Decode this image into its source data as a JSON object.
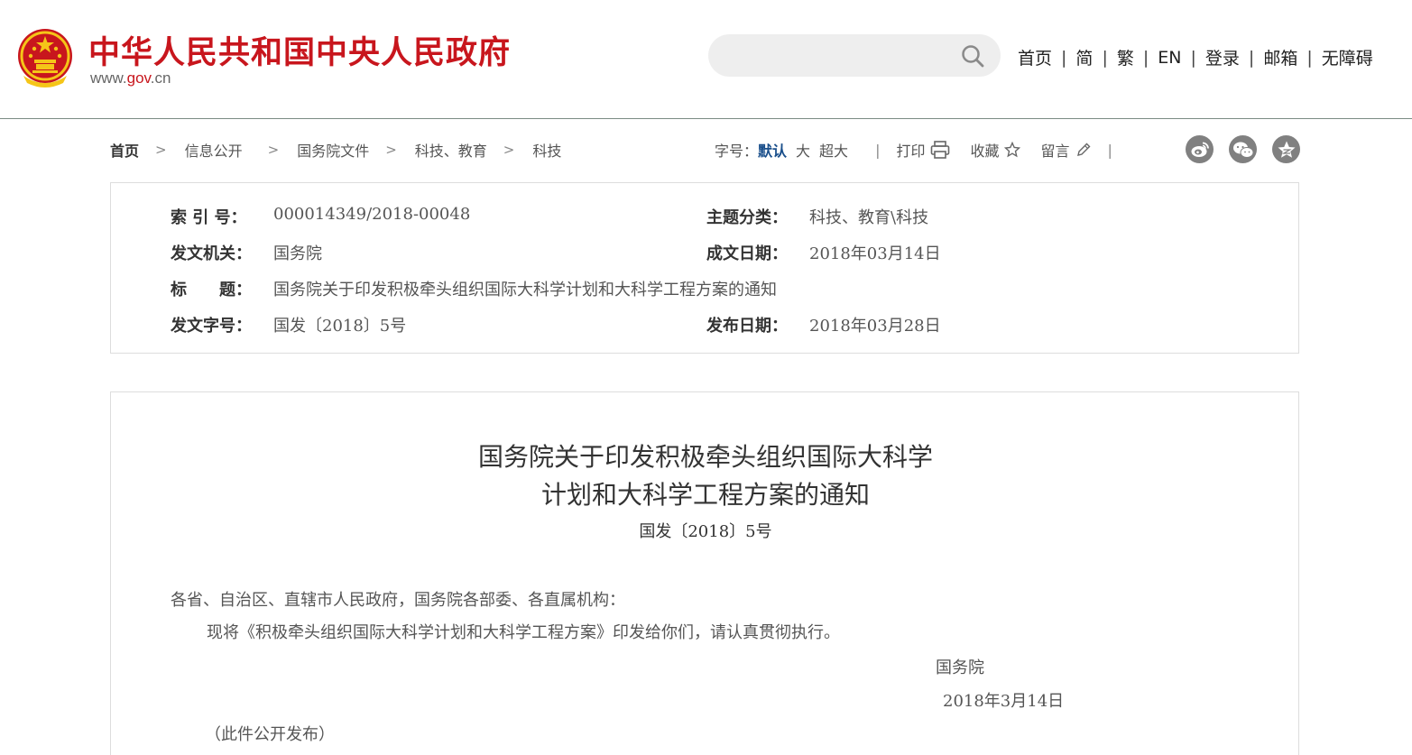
{
  "header": {
    "site_title": "中华人民共和国中央人民政府",
    "site_url_prefix": "www.",
    "site_url_domain": "gov",
    "site_url_suffix": ".cn",
    "search_placeholder": "",
    "nav": [
      "首页",
      "简",
      "繁",
      "EN",
      "登录",
      "邮箱",
      "无障碍"
    ],
    "nav_separator": "|"
  },
  "breadcrumb": {
    "items": [
      "首页",
      "信息公开",
      "国务院文件",
      "科技、教育",
      "科技"
    ],
    "separator": ">"
  },
  "toolbar": {
    "font_size_label": "字号：",
    "font_sizes": [
      "默认",
      "大",
      "超大"
    ],
    "separator": "|",
    "print": "打印",
    "favorite": "收藏",
    "comment": "留言",
    "share_icons": [
      "weibo-icon",
      "wechat-icon",
      "qzone-icon"
    ]
  },
  "info": {
    "index_label": "索 引 号：",
    "index_value": "000014349/2018-00048",
    "topic_label": "主题分类：",
    "topic_value": "科技、教育\\科技",
    "issuer_label": "发文机关：",
    "issuer_value": "国务院",
    "written_date_label": "成文日期：",
    "written_date_value": "2018年03月14日",
    "title_label": "标　　题：",
    "title_value": "国务院关于印发积极牵头组织国际大科学计划和大科学工程方案的通知",
    "doc_no_label": "发文字号：",
    "doc_no_value": "国发〔2018〕5号",
    "publish_date_label": "发布日期：",
    "publish_date_value": "2018年03月28日"
  },
  "article": {
    "title_line1": "国务院关于印发积极牵头组织国际大科学",
    "title_line2": "计划和大科学工程方案的通知",
    "doc_number": "国发〔2018〕5号",
    "salutation": "各省、自治区、直辖市人民政府，国务院各部委、各直属机构：",
    "body": "现将《积极牵头组织国际大科学计划和大科学工程方案》印发给你们，请认真贯彻执行。",
    "signer": "国务院",
    "date": "2018年3月14日",
    "note": "（此件公开发布）"
  },
  "colors": {
    "brand_red": "#c8161d",
    "emblem_gold": "#f5c518",
    "active_blue": "#1a4f8b",
    "icon_gray": "#808080"
  }
}
